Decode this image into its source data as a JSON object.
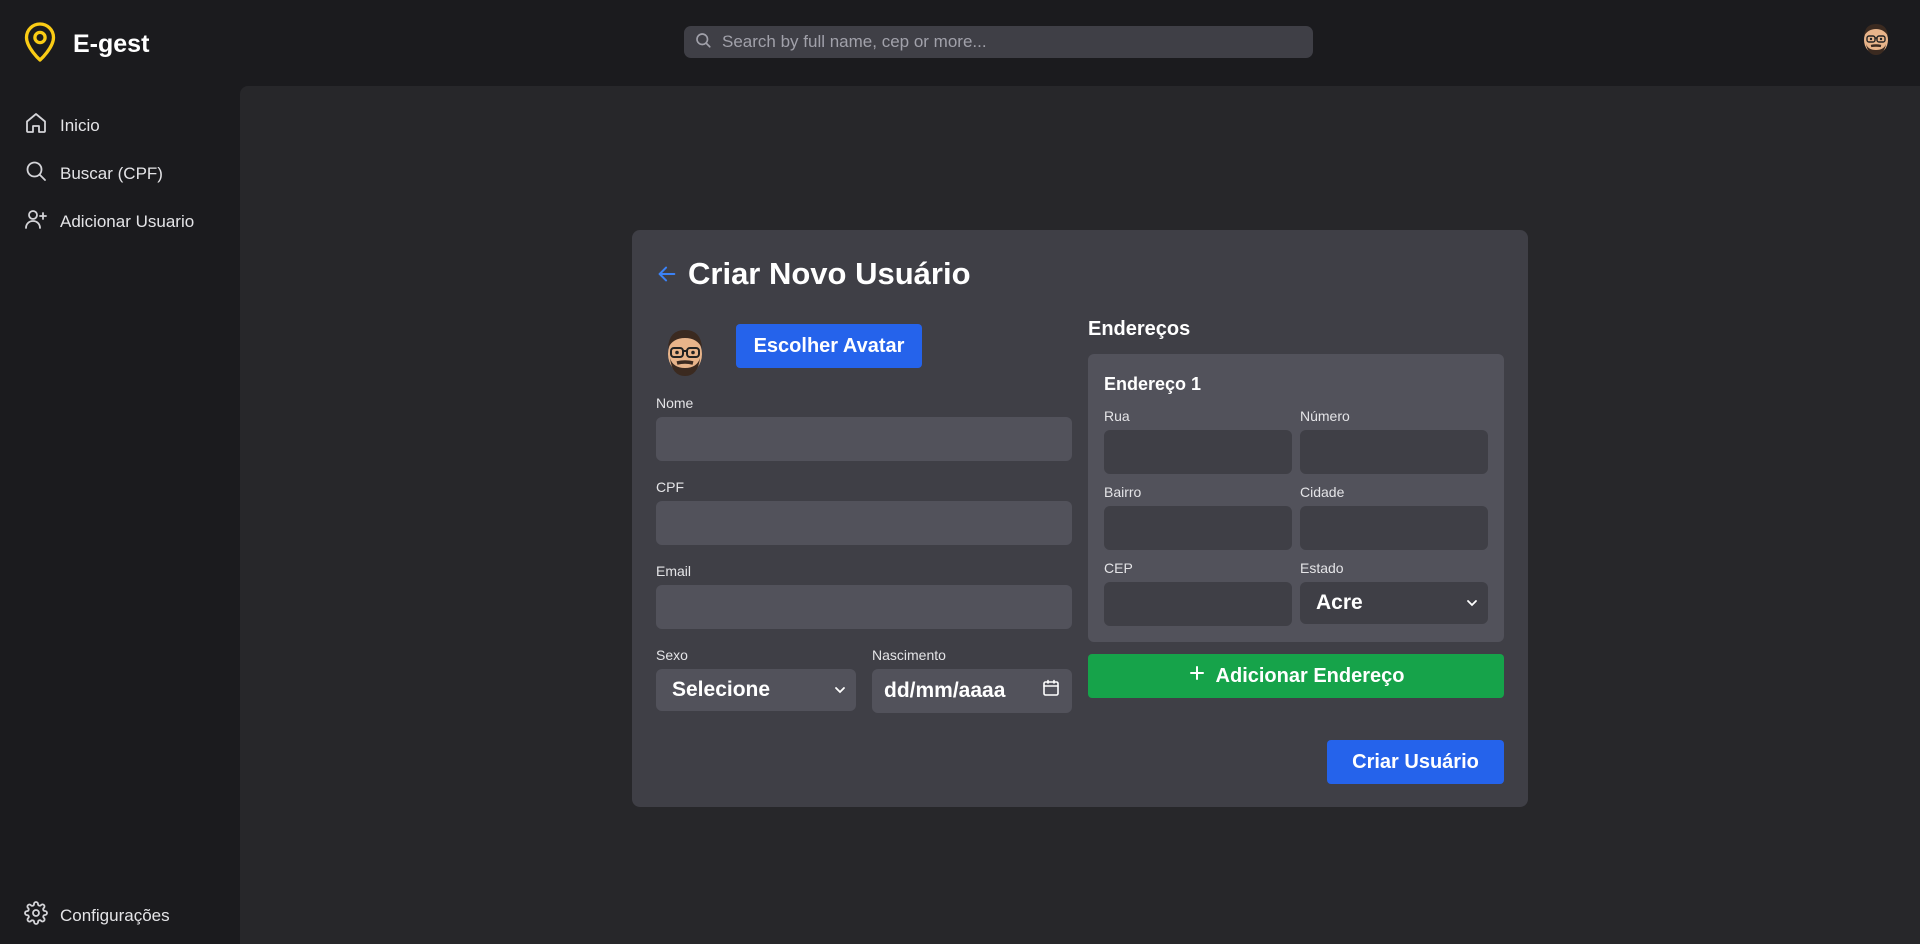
{
  "app": {
    "name": "E-gest"
  },
  "search": {
    "placeholder": "Search by full name, cep or more..."
  },
  "sidebar": {
    "items": [
      {
        "label": "Inicio",
        "icon": "home-icon"
      },
      {
        "label": "Buscar (CPF)",
        "icon": "search-icon"
      },
      {
        "label": "Adicionar Usuario",
        "icon": "user-plus-icon"
      }
    ],
    "settings_label": "Configurações"
  },
  "form": {
    "title": "Criar Novo Usuário",
    "choose_avatar_label": "Escolher Avatar",
    "nome_label": "Nome",
    "nome_value": "",
    "cpf_label": "CPF",
    "cpf_value": "",
    "email_label": "Email",
    "email_value": "",
    "sexo_label": "Sexo",
    "sexo_value": "Selecione",
    "nascimento_label": "Nascimento",
    "nascimento_value": "dd/mm/aaaa",
    "create_button": "Criar Usuário"
  },
  "addresses": {
    "title": "Endereços",
    "items": [
      {
        "title": "Endereço 1",
        "rua_label": "Rua",
        "numero_label": "Número",
        "bairro_label": "Bairro",
        "cidade_label": "Cidade",
        "cep_label": "CEP",
        "estado_label": "Estado",
        "estado_value": "Acre"
      }
    ],
    "add_button": "Adicionar Endereço"
  },
  "colors": {
    "accent_blue": "#2563eb",
    "accent_green": "#16a34a",
    "logo_yellow": "#facc15"
  }
}
